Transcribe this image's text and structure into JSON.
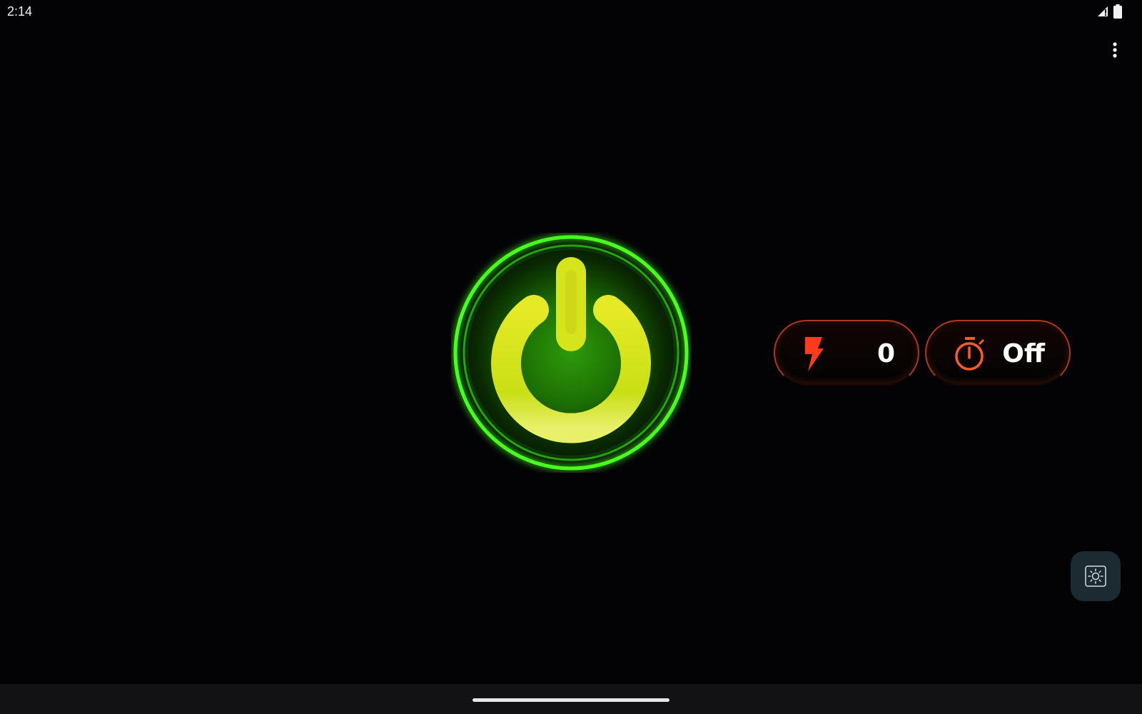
{
  "status_bar": {
    "time": "2:14",
    "icons": [
      "signal-icon",
      "battery-icon"
    ]
  },
  "menu": {
    "icon": "more-vert-icon"
  },
  "power_button": {
    "icon": "power-icon",
    "state": "on",
    "colors": {
      "ring": "#39ff14",
      "center": "#1f8a06",
      "symbol": "#d9e61a"
    }
  },
  "strobe": {
    "icon": "lightning-icon",
    "value": "0",
    "icon_color": "#ff3b1f"
  },
  "timer": {
    "icon": "stopwatch-icon",
    "value": "Off",
    "icon_color": "#ff5a2a"
  },
  "brightness_button": {
    "icon": "brightness-icon"
  },
  "colors": {
    "background": "#030306",
    "pill_border": "#a9391a",
    "fab_background": "#1c2b31",
    "nav_bar": "#121215"
  }
}
